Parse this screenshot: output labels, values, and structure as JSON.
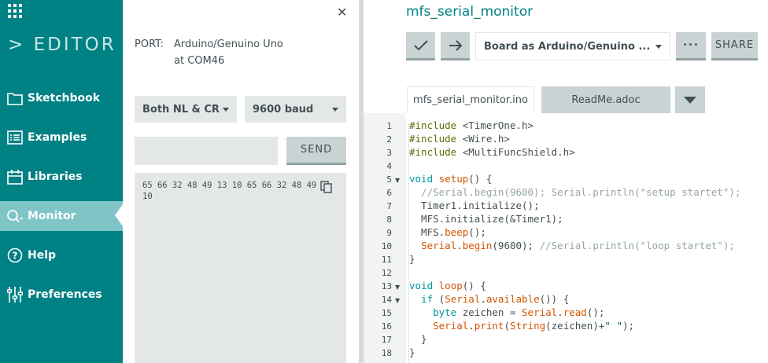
{
  "sidebar": {
    "logo_text": "EDITOR",
    "items": [
      {
        "label": "Sketchbook",
        "icon": "folder-icon"
      },
      {
        "label": "Examples",
        "icon": "list-icon"
      },
      {
        "label": "Libraries",
        "icon": "library-icon"
      },
      {
        "label": "Monitor",
        "icon": "monitor-search-icon",
        "active": true
      },
      {
        "label": "Help",
        "icon": "help-icon"
      },
      {
        "label": "Preferences",
        "icon": "sliders-icon"
      }
    ]
  },
  "monitor": {
    "port_label": "PORT:",
    "port_value_line1": "Arduino/Genuino Uno",
    "port_value_line2": "at COM46",
    "line_ending": "Both NL & CR",
    "baud_rate": "9600 baud",
    "send_input_value": "",
    "send_label": "SEND",
    "output_line1": "65 66 32 48 49 13 10 65 66 32 48 49",
    "output_line2": "10"
  },
  "editor": {
    "sketch_name": "mfs_serial_monitor",
    "board_label": "Board as Arduino/Genuino ...",
    "more_label": "•••",
    "share_label": "SHARE",
    "tabs": [
      "mfs_serial_monitor.ino",
      "ReadMe.adoc"
    ],
    "line_numbers": [
      "1",
      "2",
      "3",
      "4",
      "5",
      "6",
      "7",
      "8",
      "9",
      "10",
      "11",
      "12",
      "13",
      "14",
      "15",
      "16",
      "17",
      "18"
    ],
    "code_lines": [
      "#include <TimerOne.h>",
      "#include <Wire.h>",
      "#include <MultiFuncShield.h>",
      "",
      "void setup() {",
      "  //Serial.begin(9600); Serial.println(\"setup startet\");",
      "  Timer1.initialize();",
      "  MFS.initialize(&Timer1);",
      "  MFS.beep();",
      "  Serial.begin(9600); //Serial.println(\"loop startet\");",
      "}",
      "",
      "void loop() {",
      "  if (Serial.available()) {",
      "    byte zeichen = Serial.read();",
      "    Serial.print(String(zeichen)+\" \");",
      "  }",
      "}"
    ]
  },
  "colors": {
    "sidebar_bg": "#008184",
    "sidebar_active": "#7fc4c6",
    "accent": "#008184",
    "panel_gray": "#e3e7e6"
  }
}
